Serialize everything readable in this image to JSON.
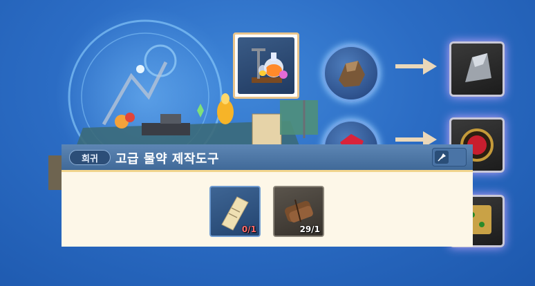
{
  "tooltip": {
    "grade_label": "희귀",
    "item_name": "고급 물약 제작도구"
  },
  "materials": [
    {
      "icon": "scroll-paper-icon",
      "count_text": "0/1",
      "count_color": "#ff6b6b"
    },
    {
      "icon": "wood-bundle-icon",
      "count_text": "29/1",
      "count_color": "#ffffff"
    }
  ],
  "colors": {
    "panel_header": "#4e79a8",
    "panel_body": "#fdf7e8",
    "accent_gold": "#f1d48d",
    "selected_border": "#e8c48c"
  }
}
